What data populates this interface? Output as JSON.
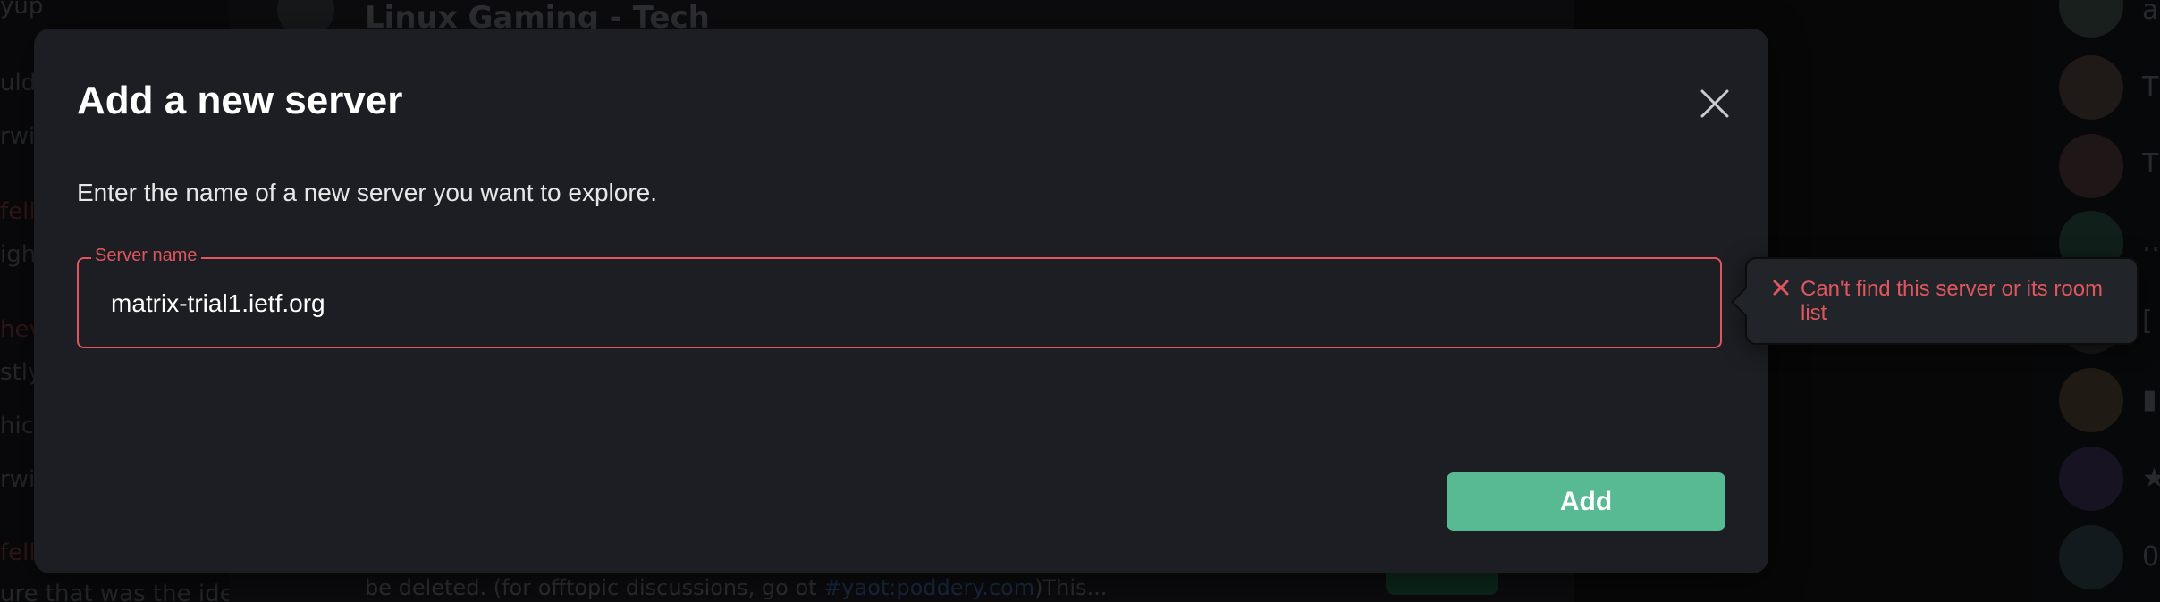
{
  "background": {
    "room_title": "Linux Gaming - Tech",
    "topic_text": "be deleted. (for offtopic discussions, go ot ",
    "topic_link": "#yaot:poddery.com",
    "topic_suffix": ")This...",
    "left_fragments": [
      "yup",
      "uld",
      "rwis",
      "fell",
      "igh",
      "hev",
      "stly",
      "hich",
      "rwis",
      "fell",
      "ure that was the ide"
    ],
    "member_letters": [
      "a",
      "T",
      "T",
      "…",
      "[",
      "▮",
      "★",
      "0"
    ]
  },
  "dialog": {
    "title": "Add a new server",
    "description": "Enter the name of a new server you want to explore.",
    "field_label": "Server name",
    "field_value": "matrix-trial1.ietf.org",
    "add_label": "Add",
    "close_icon": "close-icon"
  },
  "error_tooltip": {
    "icon": "error-x-icon",
    "message": "Can't find this server or its room list"
  },
  "colors": {
    "accent": "#57ba93",
    "error": "#e0565e",
    "dialog_bg": "#1c1e23"
  }
}
